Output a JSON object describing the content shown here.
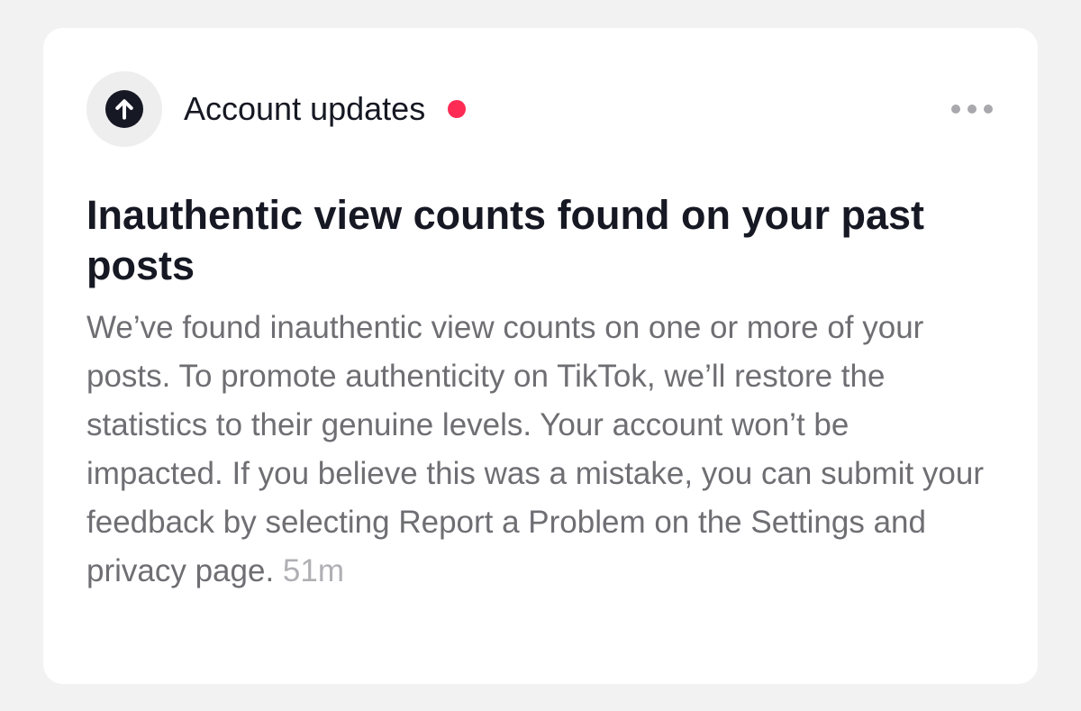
{
  "notification": {
    "category": "Account updates",
    "title": "Inauthentic view counts found on your past posts",
    "body": "We’ve found inauthentic view counts on one or more of your posts. To promote authenticity on TikTok, we’ll restore the statistics to their genuine levels. Your account won’t be impacted. If you believe this was a mistake, you can submit your feedback by selecting Report a Problem on the Settings and privacy page.",
    "timestamp": "51m",
    "unread": true,
    "icons": {
      "avatar": "arrow-up-circle-icon",
      "menu": "more-horizontal-icon"
    }
  },
  "colors": {
    "background": "#f2f2f2",
    "card": "#ffffff",
    "primary_text": "#161823",
    "secondary_text": "#6e6e73",
    "timestamp": "#b0b0b4",
    "unread_dot": "#fe2c55",
    "avatar_background": "#eeeeef",
    "menu_dots": "#a8a8ad"
  }
}
